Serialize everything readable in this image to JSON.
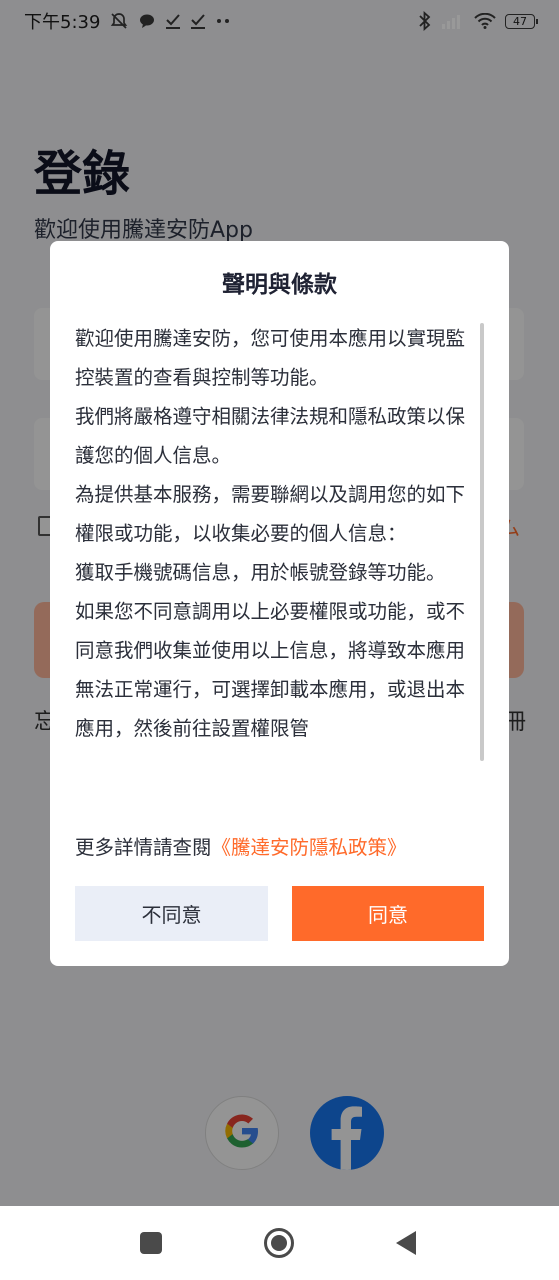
{
  "status_bar": {
    "time": "下午5:39",
    "battery_level": "47",
    "left_icons": [
      "mute-bell-icon",
      "chat-bubble-icon",
      "check-icon",
      "check-icon",
      "more-dots-icon"
    ],
    "right_icons": [
      "bluetooth-icon",
      "signal-icon",
      "wifi-icon",
      "battery-icon"
    ]
  },
  "login": {
    "title": "登錄",
    "subtitle": "歡迎使用騰達安防App",
    "policy_link_fragment": "ム",
    "forgot_fragment": "忘",
    "register_fragment": "冊",
    "social": [
      "google-icon",
      "facebook-icon"
    ]
  },
  "dialog": {
    "title": "聲明與條款",
    "paragraphs": [
      "歡迎使用騰達安防，您可使用本應用以實現監控裝置的查看與控制等功能。",
      "我們將嚴格遵守相關法律法規和隱私政策以保護您的個人信息。",
      "為提供基本服務，需要聯網以及調用您的如下權限或功能，以收集必要的個人信息：",
      "獲取手機號碼信息，用於帳號登錄等功能。",
      "如果您不同意調用以上必要權限或功能，或不同意我們收集並使用以上信息，將導致本應用無法正常運行，可選擇卸載本應用，或退出本應用，然後前往設置權限管"
    ],
    "more_prefix": "更多詳情請查閱",
    "policy_link": "《騰達安防隱私政策》",
    "disagree_label": "不同意",
    "agree_label": "同意"
  },
  "colors": {
    "accent": "#ff6a2a",
    "disagree_bg": "#eaeef7",
    "overlay": "rgba(0,0,0,0.42)"
  },
  "nav": [
    "recent-apps-icon",
    "home-icon",
    "back-icon"
  ]
}
